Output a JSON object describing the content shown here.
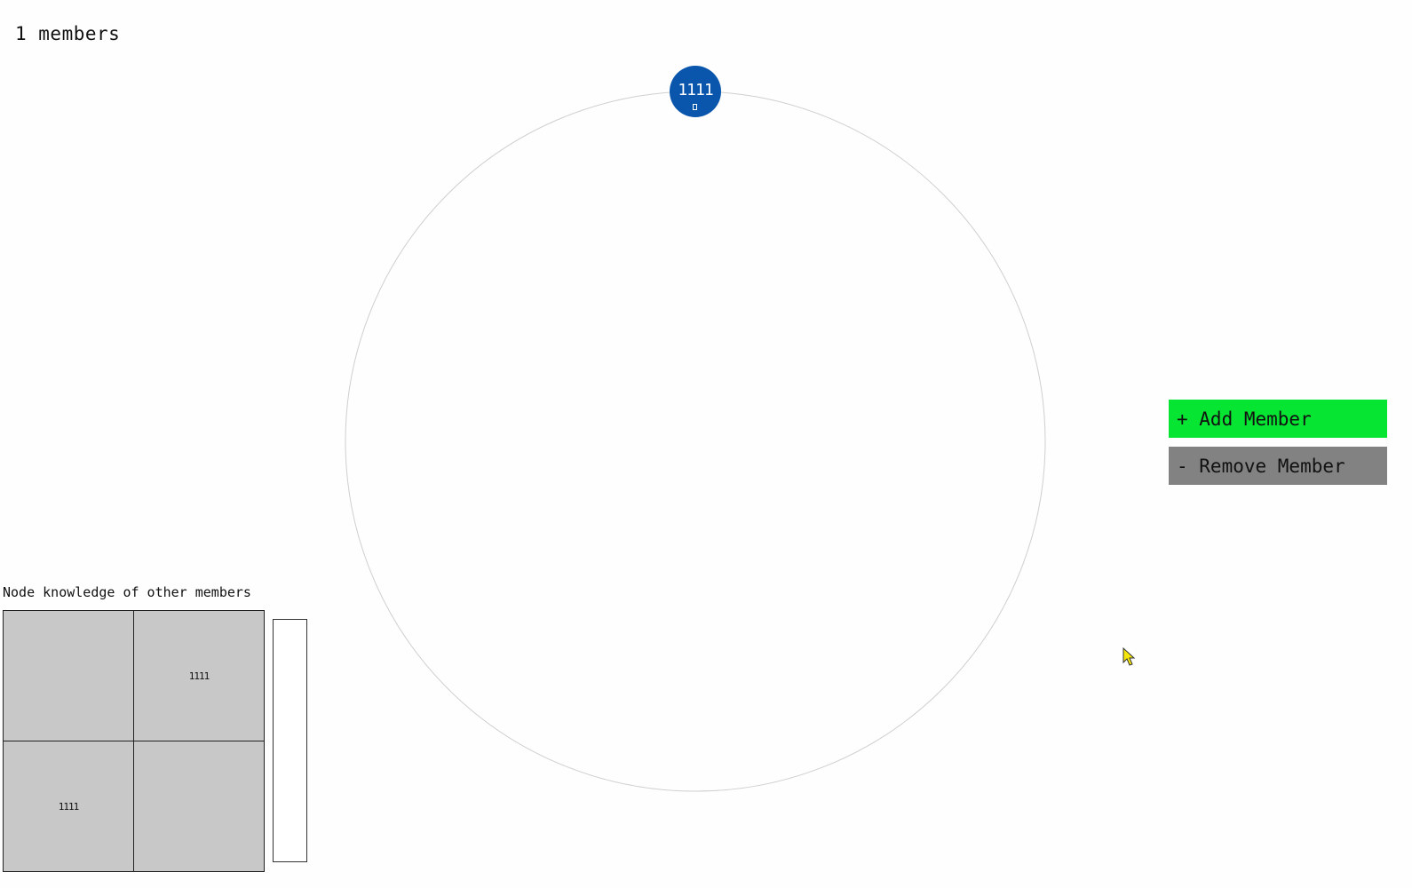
{
  "header": {
    "member_count": "1 members"
  },
  "ring": {
    "nodes": [
      {
        "id": "1111",
        "color": "#0a56ad"
      }
    ]
  },
  "controls": {
    "add_label": "+ Add Member",
    "remove_label": "- Remove Member",
    "add_color": "#06e532",
    "remove_color": "#828282"
  },
  "knowledge": {
    "title": "Node knowledge of other members",
    "matrix": [
      [
        "",
        "1111"
      ],
      [
        "1111",
        ""
      ]
    ]
  }
}
